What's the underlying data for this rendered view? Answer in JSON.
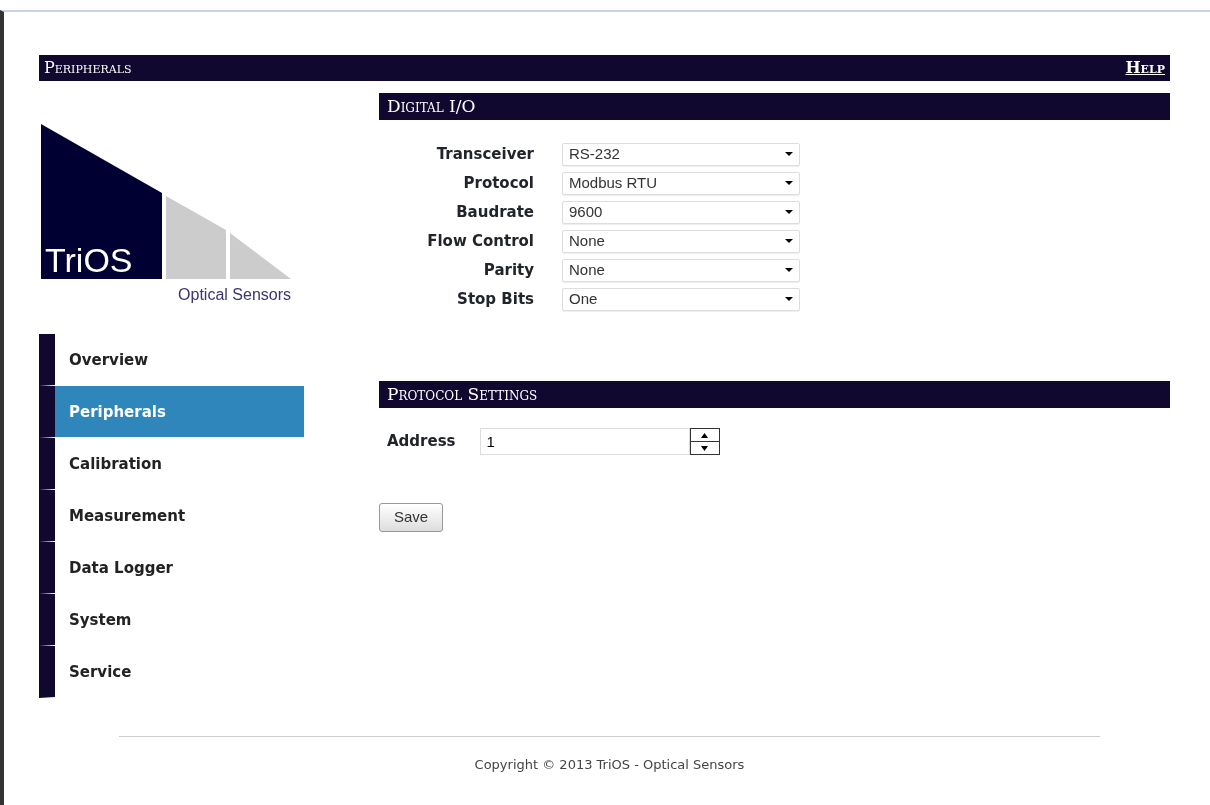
{
  "header": {
    "title": "Peripherals",
    "help_link": "Help"
  },
  "logo": {
    "brand": "TriOS",
    "tagline": "Optical Sensors"
  },
  "sidebar": {
    "items": [
      {
        "label": "Overview",
        "selected": false
      },
      {
        "label": "Peripherals",
        "selected": true
      },
      {
        "label": "Calibration",
        "selected": false
      },
      {
        "label": "Measurement",
        "selected": false
      },
      {
        "label": "Data Logger",
        "selected": false
      },
      {
        "label": "System",
        "selected": false
      },
      {
        "label": "Service",
        "selected": false
      }
    ]
  },
  "digital_io": {
    "title": "Digital I/O",
    "fields": [
      {
        "label": "Transceiver",
        "value": "RS-232"
      },
      {
        "label": "Protocol",
        "value": "Modbus RTU"
      },
      {
        "label": "Baudrate",
        "value": "9600"
      },
      {
        "label": "Flow Control",
        "value": "None"
      },
      {
        "label": "Parity",
        "value": "None"
      },
      {
        "label": "Stop Bits",
        "value": "One"
      }
    ]
  },
  "protocol_settings": {
    "title": "Protocol Settings",
    "address": {
      "label": "Address",
      "value": "1"
    }
  },
  "save_button": "Save",
  "footer": "Copyright © 2013 TriOS - Optical Sensors"
}
